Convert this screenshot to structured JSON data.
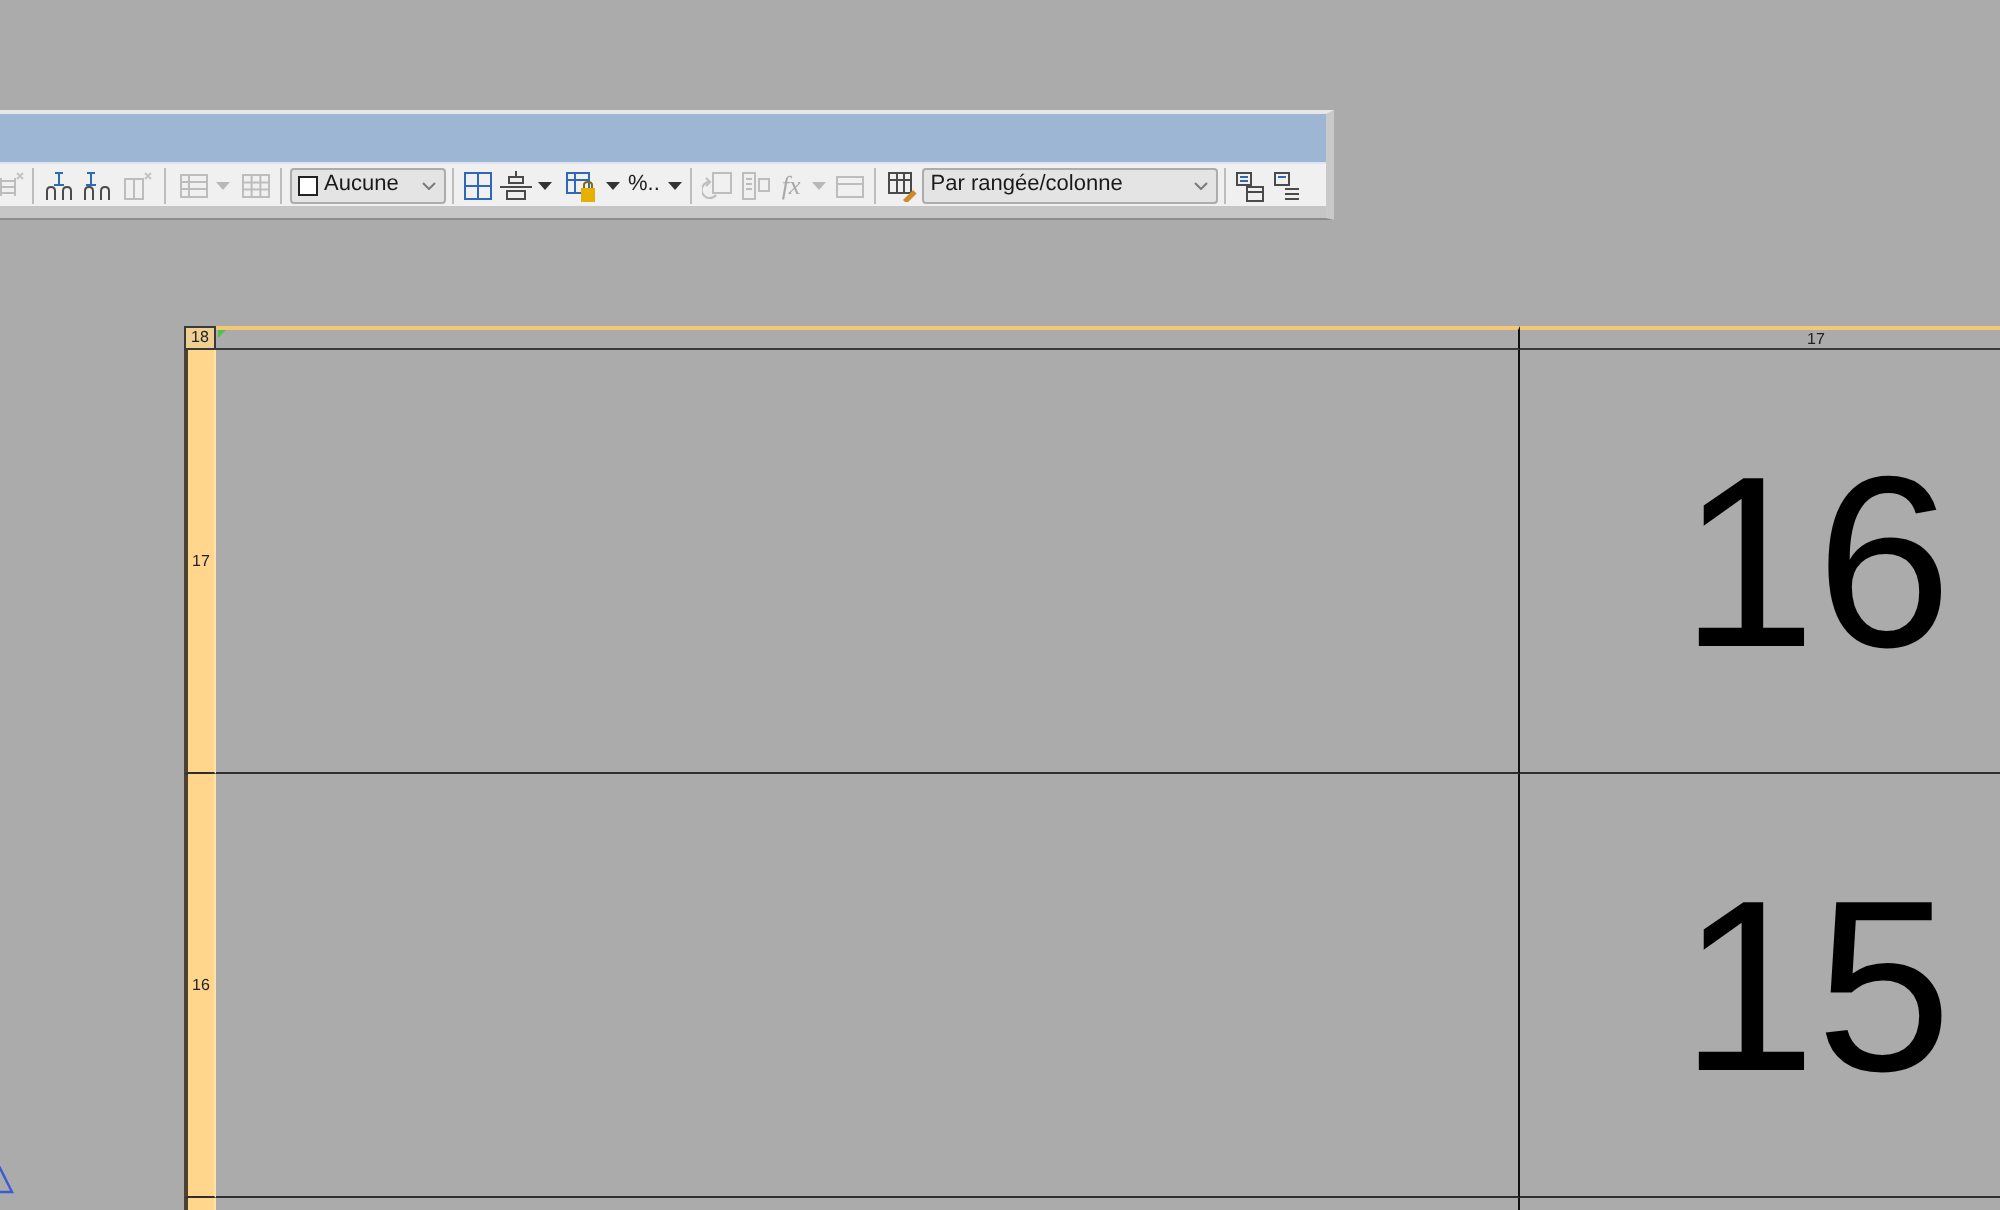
{
  "toolbar": {
    "groups": [
      {
        "items": [
          {
            "kind": "button",
            "disabled": true,
            "menu": false
          }
        ]
      },
      {
        "items": [
          {
            "kind": "button",
            "disabled": false,
            "menu": false
          },
          {
            "kind": "button",
            "disabled": false,
            "menu": false
          },
          {
            "kind": "button",
            "disabled": true,
            "menu": false
          }
        ]
      },
      {
        "items": [
          {
            "kind": "button",
            "disabled": true,
            "menu": true
          },
          {
            "kind": "button",
            "disabled": true,
            "menu": false
          }
        ]
      },
      {
        "items": [
          {
            "kind": "swatch-dropdown",
            "value": "Aucune"
          }
        ]
      },
      {
        "items": [
          {
            "kind": "button",
            "disabled": false,
            "menu": false
          },
          {
            "kind": "button",
            "disabled": false,
            "menu": true
          },
          {
            "kind": "button",
            "disabled": false,
            "menu": true
          },
          {
            "kind": "text-button",
            "label": "%..",
            "disabled": false,
            "menu": true
          }
        ]
      },
      {
        "items": [
          {
            "kind": "button",
            "disabled": true,
            "menu": false
          },
          {
            "kind": "button",
            "disabled": true,
            "menu": false
          },
          {
            "kind": "text-button",
            "label": "fx",
            "disabled": true,
            "menu": true
          },
          {
            "kind": "button",
            "disabled": true,
            "menu": false
          }
        ]
      },
      {
        "items": [
          {
            "kind": "button",
            "disabled": false,
            "menu": false
          },
          {
            "kind": "dropdown",
            "value": "Par rangée/colonne"
          }
        ]
      },
      {
        "items": [
          {
            "kind": "button",
            "disabled": false,
            "menu": false
          },
          {
            "kind": "button",
            "disabled": false,
            "menu": false
          }
        ]
      }
    ]
  },
  "sheet": {
    "corner_label": "18",
    "columns": [
      {
        "kind": "blank"
      },
      {
        "kind": "label",
        "label": "17"
      }
    ],
    "rows": [
      {
        "header": "17",
        "cells": [
          {
            "kind": "blank"
          },
          {
            "kind": "text",
            "text": "16"
          }
        ]
      },
      {
        "header": "16",
        "cells": [
          {
            "kind": "blank"
          },
          {
            "kind": "text",
            "text": "15"
          }
        ]
      }
    ]
  }
}
